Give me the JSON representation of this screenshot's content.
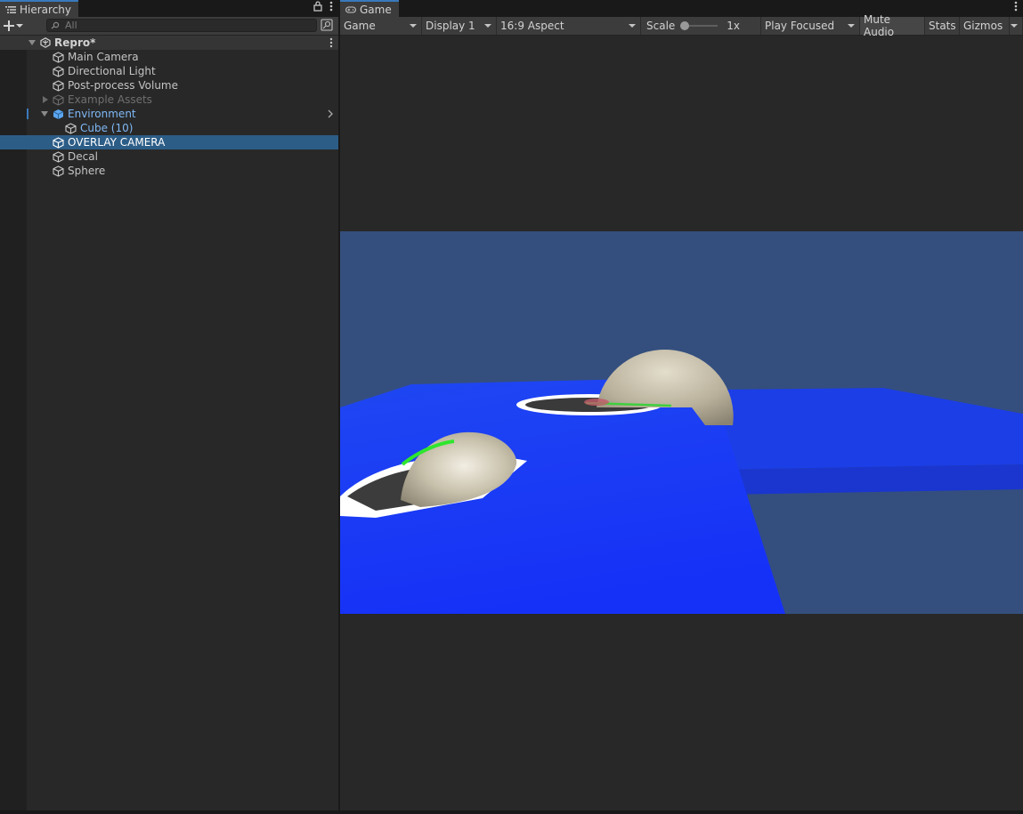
{
  "hierarchy": {
    "tab_label": "Hierarchy",
    "search_placeholder": "All",
    "scene_name": "Repro*",
    "items": [
      {
        "label": "Main Camera"
      },
      {
        "label": "Directional Light"
      },
      {
        "label": "Post-process Volume"
      },
      {
        "label": "Example Assets"
      },
      {
        "label": "Environment"
      },
      {
        "label": "Cube (10)"
      },
      {
        "label": "OVERLAY CAMERA"
      },
      {
        "label": "Decal"
      },
      {
        "label": "Sphere"
      }
    ]
  },
  "game": {
    "tab_label": "Game",
    "toolbar": {
      "view_mode": "Game",
      "display": "Display 1",
      "aspect": "16:9 Aspect",
      "scale_label": "Scale",
      "scale_value": "1x",
      "play_mode": "Play Focused",
      "mute_audio": "Mute Audio",
      "stats": "Stats",
      "gizmos": "Gizmos"
    }
  },
  "colors": {
    "accent": "#3a79bb",
    "selection": "#2c5d87",
    "prefab_text": "#7fb8f5",
    "sky": "#344f7e",
    "floor": "#1a3cf5"
  }
}
